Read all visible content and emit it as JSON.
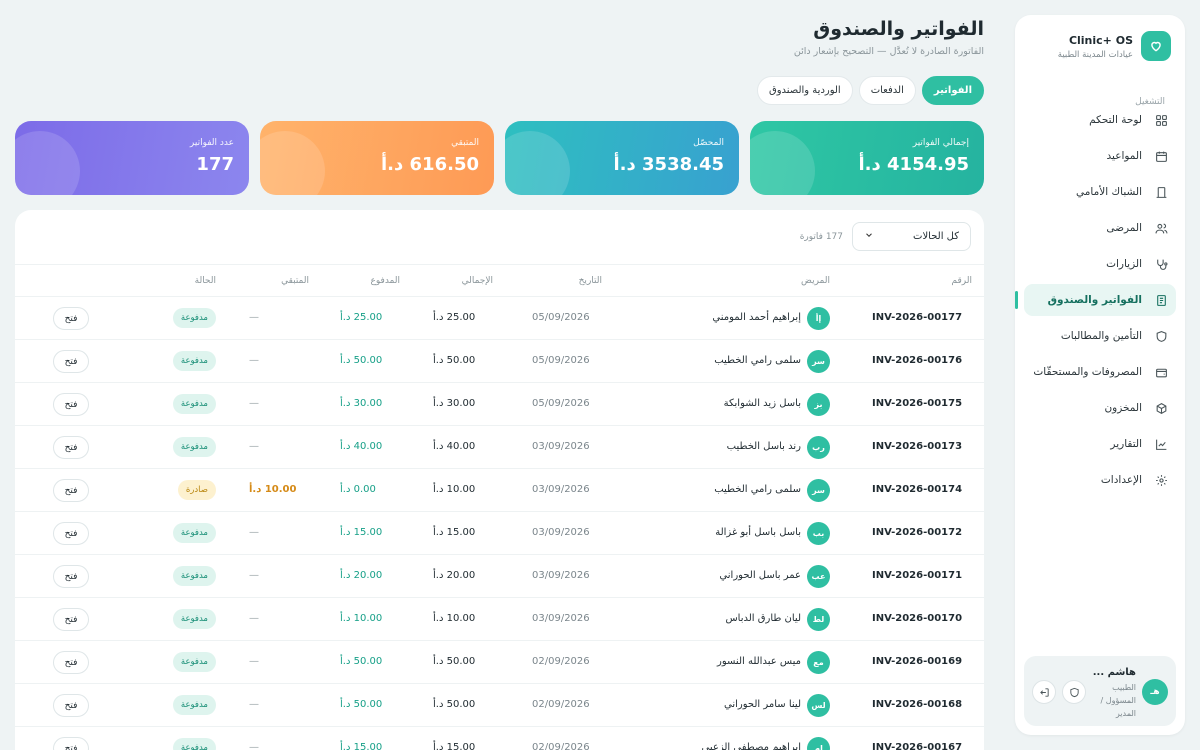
{
  "brand": {
    "name": "Clinic+ OS",
    "subtitle": "عيادات المدينة الطبية"
  },
  "nav": {
    "section": "التشغيل",
    "items": [
      {
        "label": "لوحة التحكم",
        "icon": "grid-icon"
      },
      {
        "label": "المواعيد",
        "icon": "calendar-icon"
      },
      {
        "label": "الشباك الأمامي",
        "icon": "door-icon"
      },
      {
        "label": "المرضى",
        "icon": "users-icon"
      },
      {
        "label": "الزيارات",
        "icon": "stethoscope-icon"
      },
      {
        "label": "الفواتير والصندوق",
        "icon": "receipt-icon",
        "active": true
      },
      {
        "label": "التأمين والمطالبات",
        "icon": "shield-icon"
      },
      {
        "label": "المصروفات والمستحقّات",
        "icon": "wallet-icon"
      },
      {
        "label": "المخزون",
        "icon": "box-icon"
      },
      {
        "label": "التقارير",
        "icon": "chart-icon"
      },
      {
        "label": "الإعدادات",
        "icon": "gear-icon"
      }
    ]
  },
  "user": {
    "initials": "هـ",
    "name": "هاشم ...",
    "role": "الطبيب المسؤول / المدير"
  },
  "header": {
    "title": "الفواتير والصندوق",
    "subtitle": "الفاتورة الصادرة لا تُعدَّل — التصحيح بإشعار دائن",
    "tabs": [
      "الفواتير",
      "الدفعات",
      "الوردية والصندوق"
    ]
  },
  "kpis": [
    {
      "label": "إجمالي الفواتير",
      "value": "4154.95 د.أ"
    },
    {
      "label": "المحصّل",
      "value": "3538.45 د.أ"
    },
    {
      "label": "المتبقي",
      "value": "616.50 د.أ"
    },
    {
      "label": "عدد الفواتير",
      "value": "177"
    }
  ],
  "table": {
    "filter": "كل الحالات",
    "count": "177 فاتورة",
    "columns": {
      "number": "الرقم",
      "patient": "المريض",
      "date": "التاريخ",
      "total": "الإجمالي",
      "paid": "المدفوع",
      "remaining": "المتبقي",
      "status": "الحالة"
    },
    "open_label": "فتح",
    "rows": [
      {
        "number": "INV-2026-00177",
        "initials": "إأ",
        "patient": "إبراهيم أحمد المومني",
        "date": "05/09/2026",
        "total": "25.00 د.أ",
        "paid": "25.00 د.أ",
        "remaining": "—",
        "status": "مدفوعة",
        "status_type": "paid"
      },
      {
        "number": "INV-2026-00176",
        "initials": "سر",
        "patient": "سلمى رامي الخطيب",
        "date": "05/09/2026",
        "total": "50.00 د.أ",
        "paid": "50.00 د.أ",
        "remaining": "—",
        "status": "مدفوعة",
        "status_type": "paid"
      },
      {
        "number": "INV-2026-00175",
        "initials": "بز",
        "patient": "باسل زيد الشوابكة",
        "date": "05/09/2026",
        "total": "30.00 د.أ",
        "paid": "30.00 د.أ",
        "remaining": "—",
        "status": "مدفوعة",
        "status_type": "paid"
      },
      {
        "number": "INV-2026-00173",
        "initials": "رب",
        "patient": "رند باسل الخطيب",
        "date": "03/09/2026",
        "total": "40.00 د.أ",
        "paid": "40.00 د.أ",
        "remaining": "—",
        "status": "مدفوعة",
        "status_type": "paid"
      },
      {
        "number": "INV-2026-00174",
        "initials": "سر",
        "patient": "سلمى رامي الخطيب",
        "date": "03/09/2026",
        "total": "10.00 د.أ",
        "paid": "0.00 د.أ",
        "remaining": "10.00 د.أ",
        "status": "صادرة",
        "status_type": "issued"
      },
      {
        "number": "INV-2026-00172",
        "initials": "بب",
        "patient": "باسل باسل أبو غزالة",
        "date": "03/09/2026",
        "total": "15.00 د.أ",
        "paid": "15.00 د.أ",
        "remaining": "—",
        "status": "مدفوعة",
        "status_type": "paid"
      },
      {
        "number": "INV-2026-00171",
        "initials": "عب",
        "patient": "عمر باسل الحوراني",
        "date": "03/09/2026",
        "total": "20.00 د.أ",
        "paid": "20.00 د.أ",
        "remaining": "—",
        "status": "مدفوعة",
        "status_type": "paid"
      },
      {
        "number": "INV-2026-00170",
        "initials": "لط",
        "patient": "ليان طارق الدباس",
        "date": "03/09/2026",
        "total": "10.00 د.أ",
        "paid": "10.00 د.أ",
        "remaining": "—",
        "status": "مدفوعة",
        "status_type": "paid"
      },
      {
        "number": "INV-2026-00169",
        "initials": "مع",
        "patient": "ميس عبدالله النسور",
        "date": "02/09/2026",
        "total": "50.00 د.أ",
        "paid": "50.00 د.أ",
        "remaining": "—",
        "status": "مدفوعة",
        "status_type": "paid"
      },
      {
        "number": "INV-2026-00168",
        "initials": "لس",
        "patient": "لينا سامر الحوراني",
        "date": "02/09/2026",
        "total": "50.00 د.أ",
        "paid": "50.00 د.أ",
        "remaining": "—",
        "status": "مدفوعة",
        "status_type": "paid"
      },
      {
        "number": "INV-2026-00167",
        "initials": "إم",
        "patient": "إبراهيم مصطفى الزعبي",
        "date": "02/09/2026",
        "total": "15.00 د.أ",
        "paid": "15.00 د.أ",
        "remaining": "—",
        "status": "مدفوعة",
        "status_type": "paid"
      }
    ]
  },
  "colors": {
    "accent": "#2fbfa2",
    "paid": "#198f77",
    "issued": "#b9860f"
  }
}
